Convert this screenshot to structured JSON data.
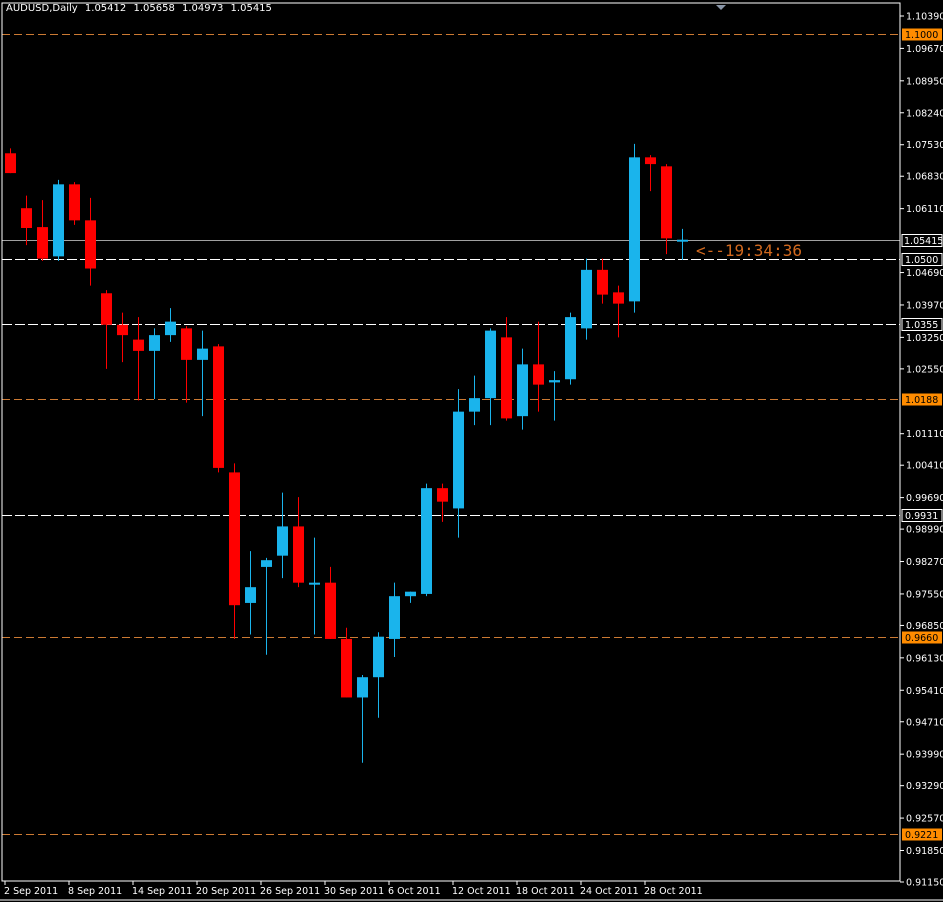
{
  "window": {
    "symbol": "AUDUSD,Daily",
    "open": "1.05412",
    "high": "1.05658",
    "low": "1.04973",
    "close": "1.05415"
  },
  "countdown": "<--19:34:36",
  "colors": {
    "background": "#000000",
    "bull": "#1ab4ec",
    "bear": "#ff0000",
    "hline_orange": "#cc7a33",
    "hline_white": "#ffffff",
    "axis": "#ffffff",
    "countdown": "#d2691e"
  },
  "chart_data": {
    "type": "candlestick",
    "ylim": [
      0.9115,
      1.1039
    ],
    "price_ticks": [
      "1.10390",
      "1.09670",
      "1.08950",
      "1.08240",
      "1.07530",
      "1.06830",
      "1.06110",
      "1.04690",
      "1.03970",
      "1.03250",
      "1.02550",
      "1.01110",
      "1.00410",
      "0.99690",
      "0.98990",
      "0.98270",
      "0.97550",
      "0.96850",
      "0.96130",
      "0.95410",
      "0.94710",
      "0.93990",
      "0.93290",
      "0.92570",
      "0.91850",
      "0.91150"
    ],
    "date_ticks": [
      {
        "label": "2 Sep 2011",
        "index": 0
      },
      {
        "label": "8 Sep 2011",
        "index": 4
      },
      {
        "label": "14 Sep 2011",
        "index": 8
      },
      {
        "label": "20 Sep 2011",
        "index": 12
      },
      {
        "label": "26 Sep 2011",
        "index": 16
      },
      {
        "label": "30 Sep 2011",
        "index": 20
      },
      {
        "label": "6 Oct 2011",
        "index": 24
      },
      {
        "label": "12 Oct 2011",
        "index": 28
      },
      {
        "label": "18 Oct 2011",
        "index": 32
      },
      {
        "label": "24 Oct 2011",
        "index": 36
      },
      {
        "label": "28 Oct 2011",
        "index": 40
      }
    ],
    "current_price": {
      "value": 1.05415,
      "label": "1.05415"
    },
    "levels": [
      {
        "value": 1.1,
        "label": "1.1000",
        "style": "orange"
      },
      {
        "value": 1.05,
        "label": "1.0500",
        "style": "white"
      },
      {
        "value": 1.0355,
        "label": "1.0355",
        "style": "white"
      },
      {
        "value": 1.0188,
        "label": "1.0188",
        "style": "orange"
      },
      {
        "value": 0.9931,
        "label": "0.9931",
        "style": "white"
      },
      {
        "value": 0.966,
        "label": "0.9660",
        "style": "orange"
      },
      {
        "value": 0.9221,
        "label": "0.9221",
        "style": "orange"
      }
    ],
    "candles": [
      {
        "o": 1.0734,
        "h": 1.0745,
        "l": 1.069,
        "c": 1.069
      },
      {
        "o": 1.0612,
        "h": 1.064,
        "l": 1.053,
        "c": 1.0568
      },
      {
        "o": 1.057,
        "h": 1.063,
        "l": 1.0495,
        "c": 1.05
      },
      {
        "o": 1.0505,
        "h": 1.0675,
        "l": 1.0495,
        "c": 1.0665
      },
      {
        "o": 1.0665,
        "h": 1.067,
        "l": 1.0575,
        "c": 1.0585
      },
      {
        "o": 1.0585,
        "h": 1.0635,
        "l": 1.044,
        "c": 1.0478
      },
      {
        "o": 1.0423,
        "h": 1.043,
        "l": 1.0255,
        "c": 1.0353
      },
      {
        "o": 1.0353,
        "h": 1.038,
        "l": 1.027,
        "c": 1.033
      },
      {
        "o": 1.032,
        "h": 1.037,
        "l": 1.0185,
        "c": 1.0295
      },
      {
        "o": 1.0295,
        "h": 1.0345,
        "l": 1.0188,
        "c": 1.033
      },
      {
        "o": 1.033,
        "h": 1.039,
        "l": 1.0315,
        "c": 1.036
      },
      {
        "o": 1.0345,
        "h": 1.035,
        "l": 1.018,
        "c": 1.0275
      },
      {
        "o": 1.0275,
        "h": 1.034,
        "l": 1.015,
        "c": 1.03
      },
      {
        "o": 1.0305,
        "h": 1.031,
        "l": 1.0025,
        "c": 1.0035
      },
      {
        "o": 1.0025,
        "h": 1.0045,
        "l": 0.9655,
        "c": 0.973
      },
      {
        "o": 0.9735,
        "h": 0.985,
        "l": 0.9665,
        "c": 0.977
      },
      {
        "o": 0.9815,
        "h": 0.9835,
        "l": 0.962,
        "c": 0.983
      },
      {
        "o": 0.984,
        "h": 0.998,
        "l": 0.979,
        "c": 0.9905
      },
      {
        "o": 0.9905,
        "h": 0.997,
        "l": 0.977,
        "c": 0.978
      },
      {
        "o": 0.978,
        "h": 0.988,
        "l": 0.9665,
        "c": 0.978
      },
      {
        "o": 0.978,
        "h": 0.9815,
        "l": 0.9655,
        "c": 0.9655
      },
      {
        "o": 0.9655,
        "h": 0.968,
        "l": 0.9525,
        "c": 0.9525
      },
      {
        "o": 0.9525,
        "h": 0.9575,
        "l": 0.938,
        "c": 0.957
      },
      {
        "o": 0.957,
        "h": 0.967,
        "l": 0.948,
        "c": 0.966
      },
      {
        "o": 0.9655,
        "h": 0.978,
        "l": 0.9615,
        "c": 0.975
      },
      {
        "o": 0.975,
        "h": 0.976,
        "l": 0.9735,
        "c": 0.976
      },
      {
        "o": 0.9755,
        "h": 1.0,
        "l": 0.975,
        "c": 0.999
      },
      {
        "o": 0.999,
        "h": 1.0,
        "l": 0.9915,
        "c": 0.996
      },
      {
        "o": 0.9945,
        "h": 1.021,
        "l": 0.988,
        "c": 1.016
      },
      {
        "o": 1.016,
        "h": 1.024,
        "l": 1.013,
        "c": 1.019
      },
      {
        "o": 1.019,
        "h": 1.0345,
        "l": 1.013,
        "c": 1.034
      },
      {
        "o": 1.0325,
        "h": 1.037,
        "l": 1.014,
        "c": 1.0145
      },
      {
        "o": 1.015,
        "h": 1.03,
        "l": 1.012,
        "c": 1.0265
      },
      {
        "o": 1.0265,
        "h": 1.036,
        "l": 1.016,
        "c": 1.022
      },
      {
        "o": 1.0225,
        "h": 1.025,
        "l": 1.014,
        "c": 1.023
      },
      {
        "o": 1.0232,
        "h": 1.038,
        "l": 1.022,
        "c": 1.037
      },
      {
        "o": 1.0345,
        "h": 1.05,
        "l": 1.032,
        "c": 1.0475
      },
      {
        "o": 1.0475,
        "h": 1.05,
        "l": 1.04,
        "c": 1.042
      },
      {
        "o": 1.0425,
        "h": 1.044,
        "l": 1.0325,
        "c": 1.04
      },
      {
        "o": 1.0405,
        "h": 1.0755,
        "l": 1.038,
        "c": 1.0725
      },
      {
        "o": 1.0725,
        "h": 1.073,
        "l": 1.065,
        "c": 1.071
      },
      {
        "o": 1.0705,
        "h": 1.071,
        "l": 1.051,
        "c": 1.0545
      },
      {
        "o": 1.0541,
        "h": 1.0566,
        "l": 1.0497,
        "c": 1.0542
      }
    ]
  }
}
